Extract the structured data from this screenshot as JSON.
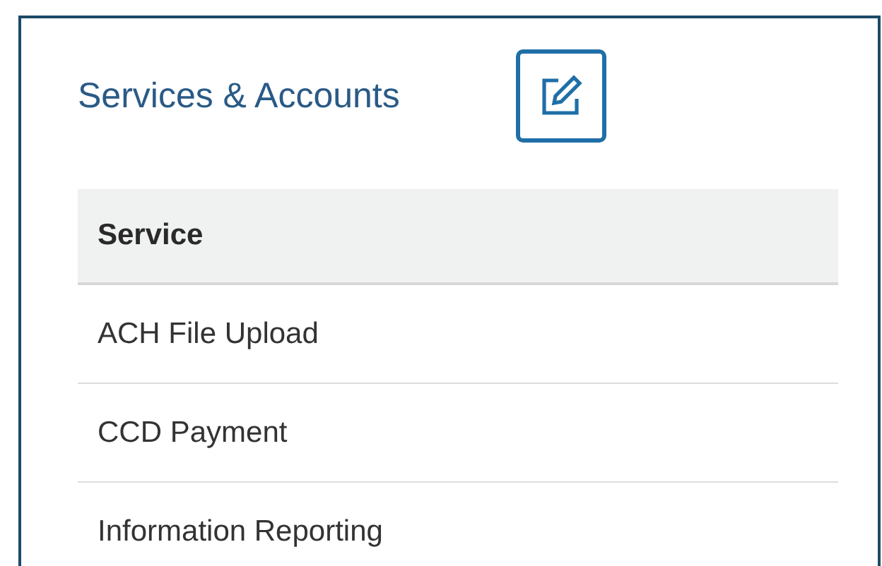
{
  "panel": {
    "title": "Services & Accounts"
  },
  "table": {
    "columns": [
      "Service"
    ],
    "rows": [
      {
        "service": "ACH File Upload"
      },
      {
        "service": "CCD Payment"
      },
      {
        "service": "Information Reporting"
      }
    ]
  }
}
